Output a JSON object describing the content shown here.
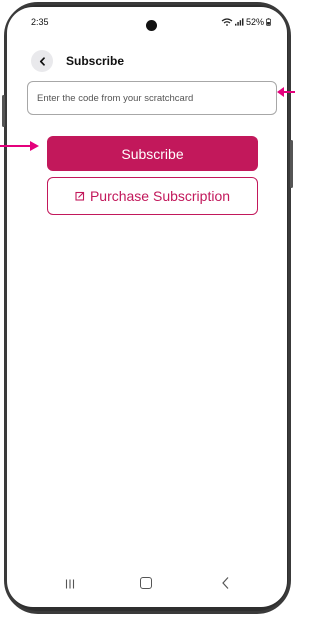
{
  "status_bar": {
    "time": "2:35",
    "battery": "52%",
    "icons": [
      "wifi-icon",
      "signal-icon",
      "battery-icon"
    ]
  },
  "header": {
    "title": "Subscribe",
    "back_icon": "chevron-left-icon"
  },
  "form": {
    "code_placeholder": "Enter the code from your scratchcard",
    "code_value": "",
    "subscribe_label": "Subscribe",
    "purchase_label": "Purchase Subscription",
    "purchase_icon": "external-link-icon"
  },
  "nav_bar": {
    "icons": [
      "recent-apps-icon",
      "home-icon",
      "back-icon"
    ]
  },
  "colors": {
    "accent": "#c2185b",
    "annotation_arrow": "#e4007c",
    "frame": "#2e2e2e"
  }
}
